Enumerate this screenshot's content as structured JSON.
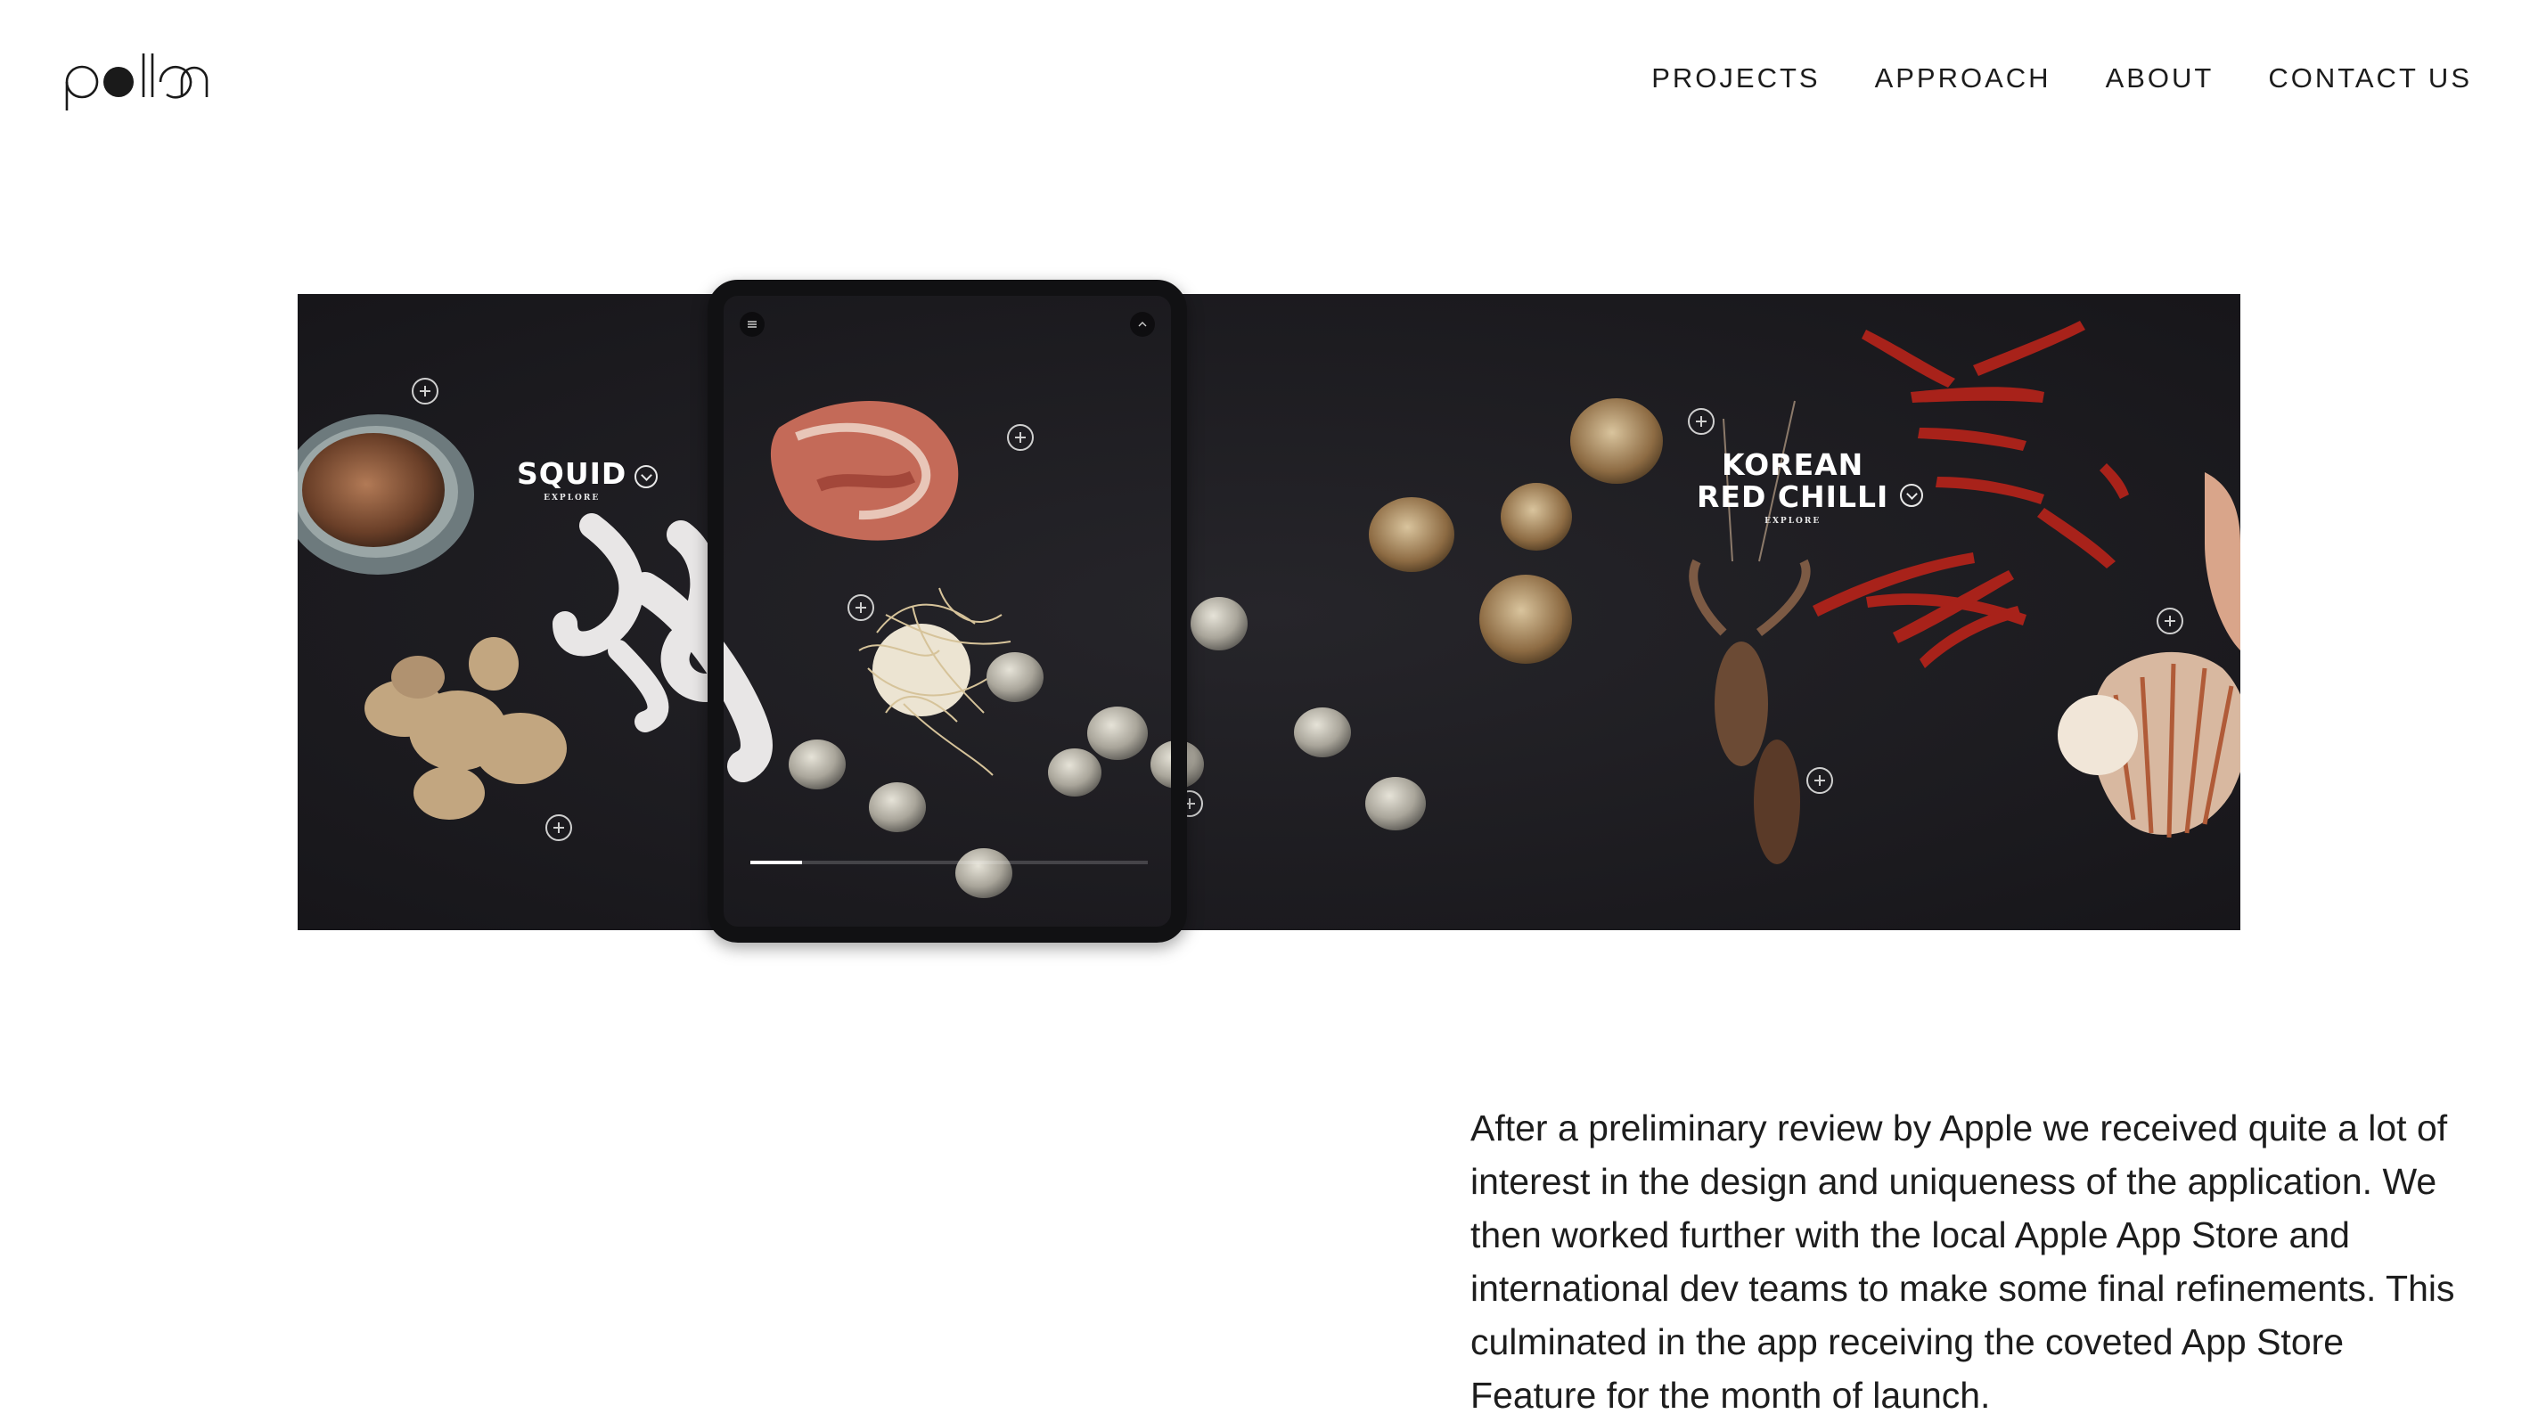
{
  "header": {
    "logo_text": "pollen",
    "nav": [
      "PROJECTS",
      "APPROACH",
      "ABOUT",
      "CONTACT US"
    ]
  },
  "showcase": {
    "labels": [
      {
        "title": "SQUID",
        "sub": "EXPLORE"
      },
      {
        "title_line1": "KOREAN",
        "title_line2": "RED CHILLI",
        "sub": "EXPLORE"
      }
    ],
    "device_progress": 0.13,
    "background_color": "#1d1c20",
    "device_frame_color": "#111113"
  },
  "body": {
    "paragraph": "After a preliminary review by Apple we received quite a lot of interest in the design and uniqueness of the application. We then worked further with the local Apple App Store and international dev teams to make some final refinements. This culminated in the app receiving the coveted App Store Feature for the month of launch."
  }
}
